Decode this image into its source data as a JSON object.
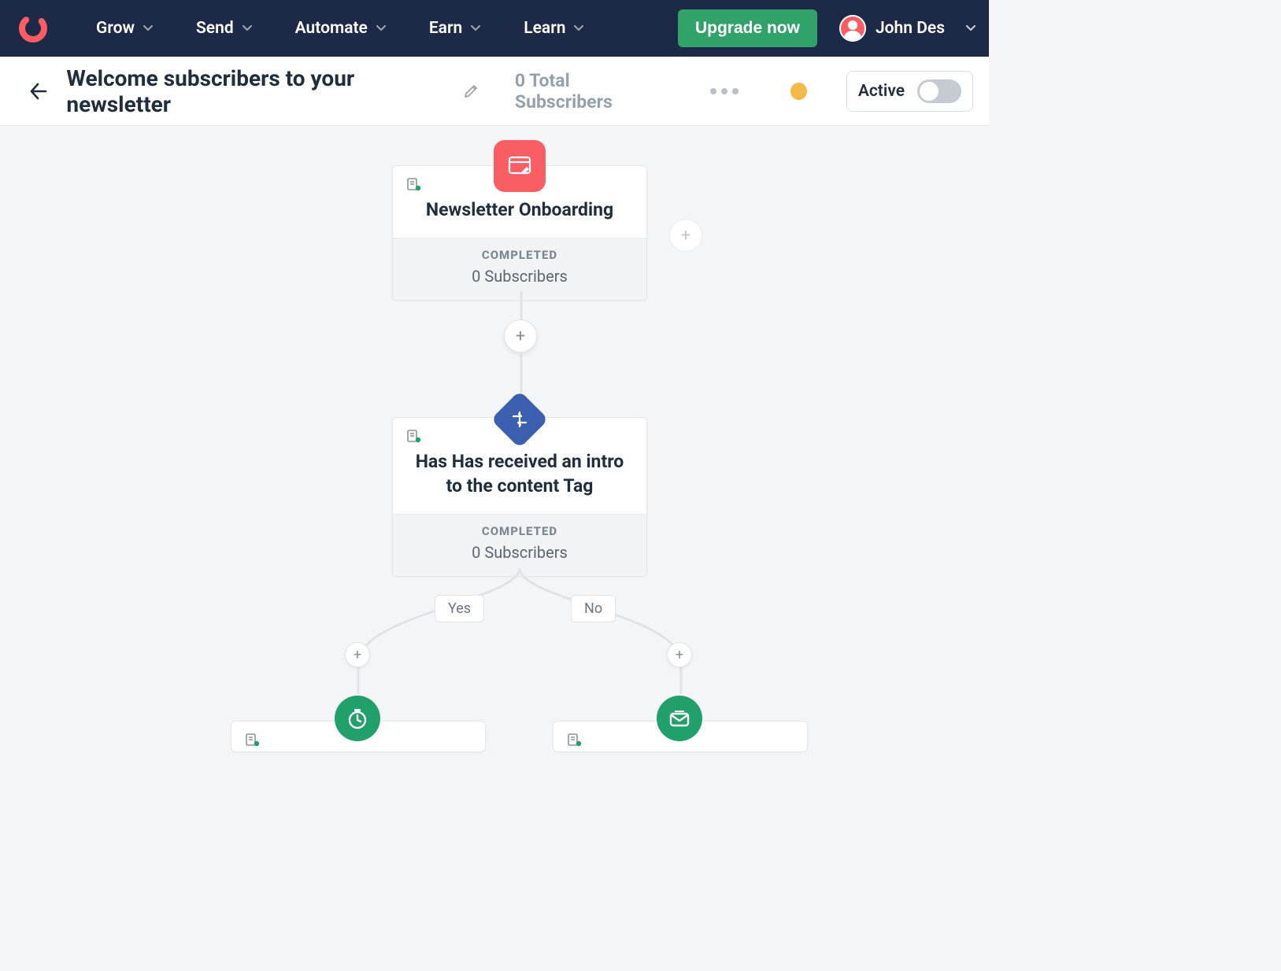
{
  "nav": {
    "items": [
      "Grow",
      "Send",
      "Automate",
      "Earn",
      "Learn"
    ],
    "upgrade": "Upgrade now",
    "username": "John Des"
  },
  "subheader": {
    "title": "Welcome subscribers to your newsletter",
    "total_subs": "0 Total Subscribers",
    "active_label": "Active"
  },
  "nodes": {
    "n1": {
      "title": "Newsletter Onboarding",
      "status": "COMPLETED",
      "subs": "0 Subscribers"
    },
    "n2": {
      "title": "Has Has received an intro to the content Tag",
      "status": "COMPLETED",
      "subs": "0 Subscribers"
    }
  },
  "branches": {
    "yes": "Yes",
    "no": "No"
  }
}
